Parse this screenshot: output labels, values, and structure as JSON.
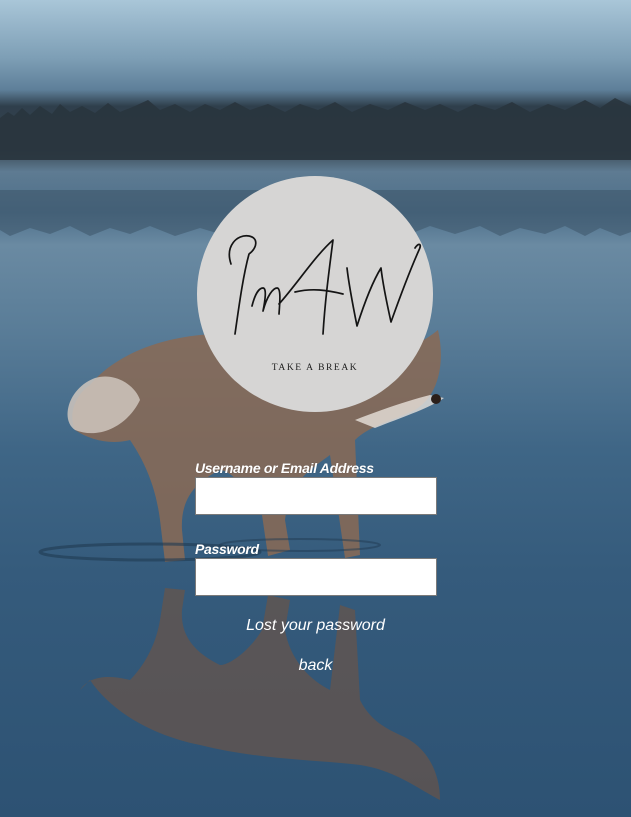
{
  "logo": {
    "monogram": "ImAW",
    "tagline": "TAKE A BREAK"
  },
  "form": {
    "username_label": "Username or Email Address",
    "username_value": "",
    "password_label": "Password",
    "password_value": ""
  },
  "links": {
    "lost_password": "Lost your password",
    "back": "back"
  },
  "background": {
    "description_icon": "husky-on-lake-photo"
  }
}
